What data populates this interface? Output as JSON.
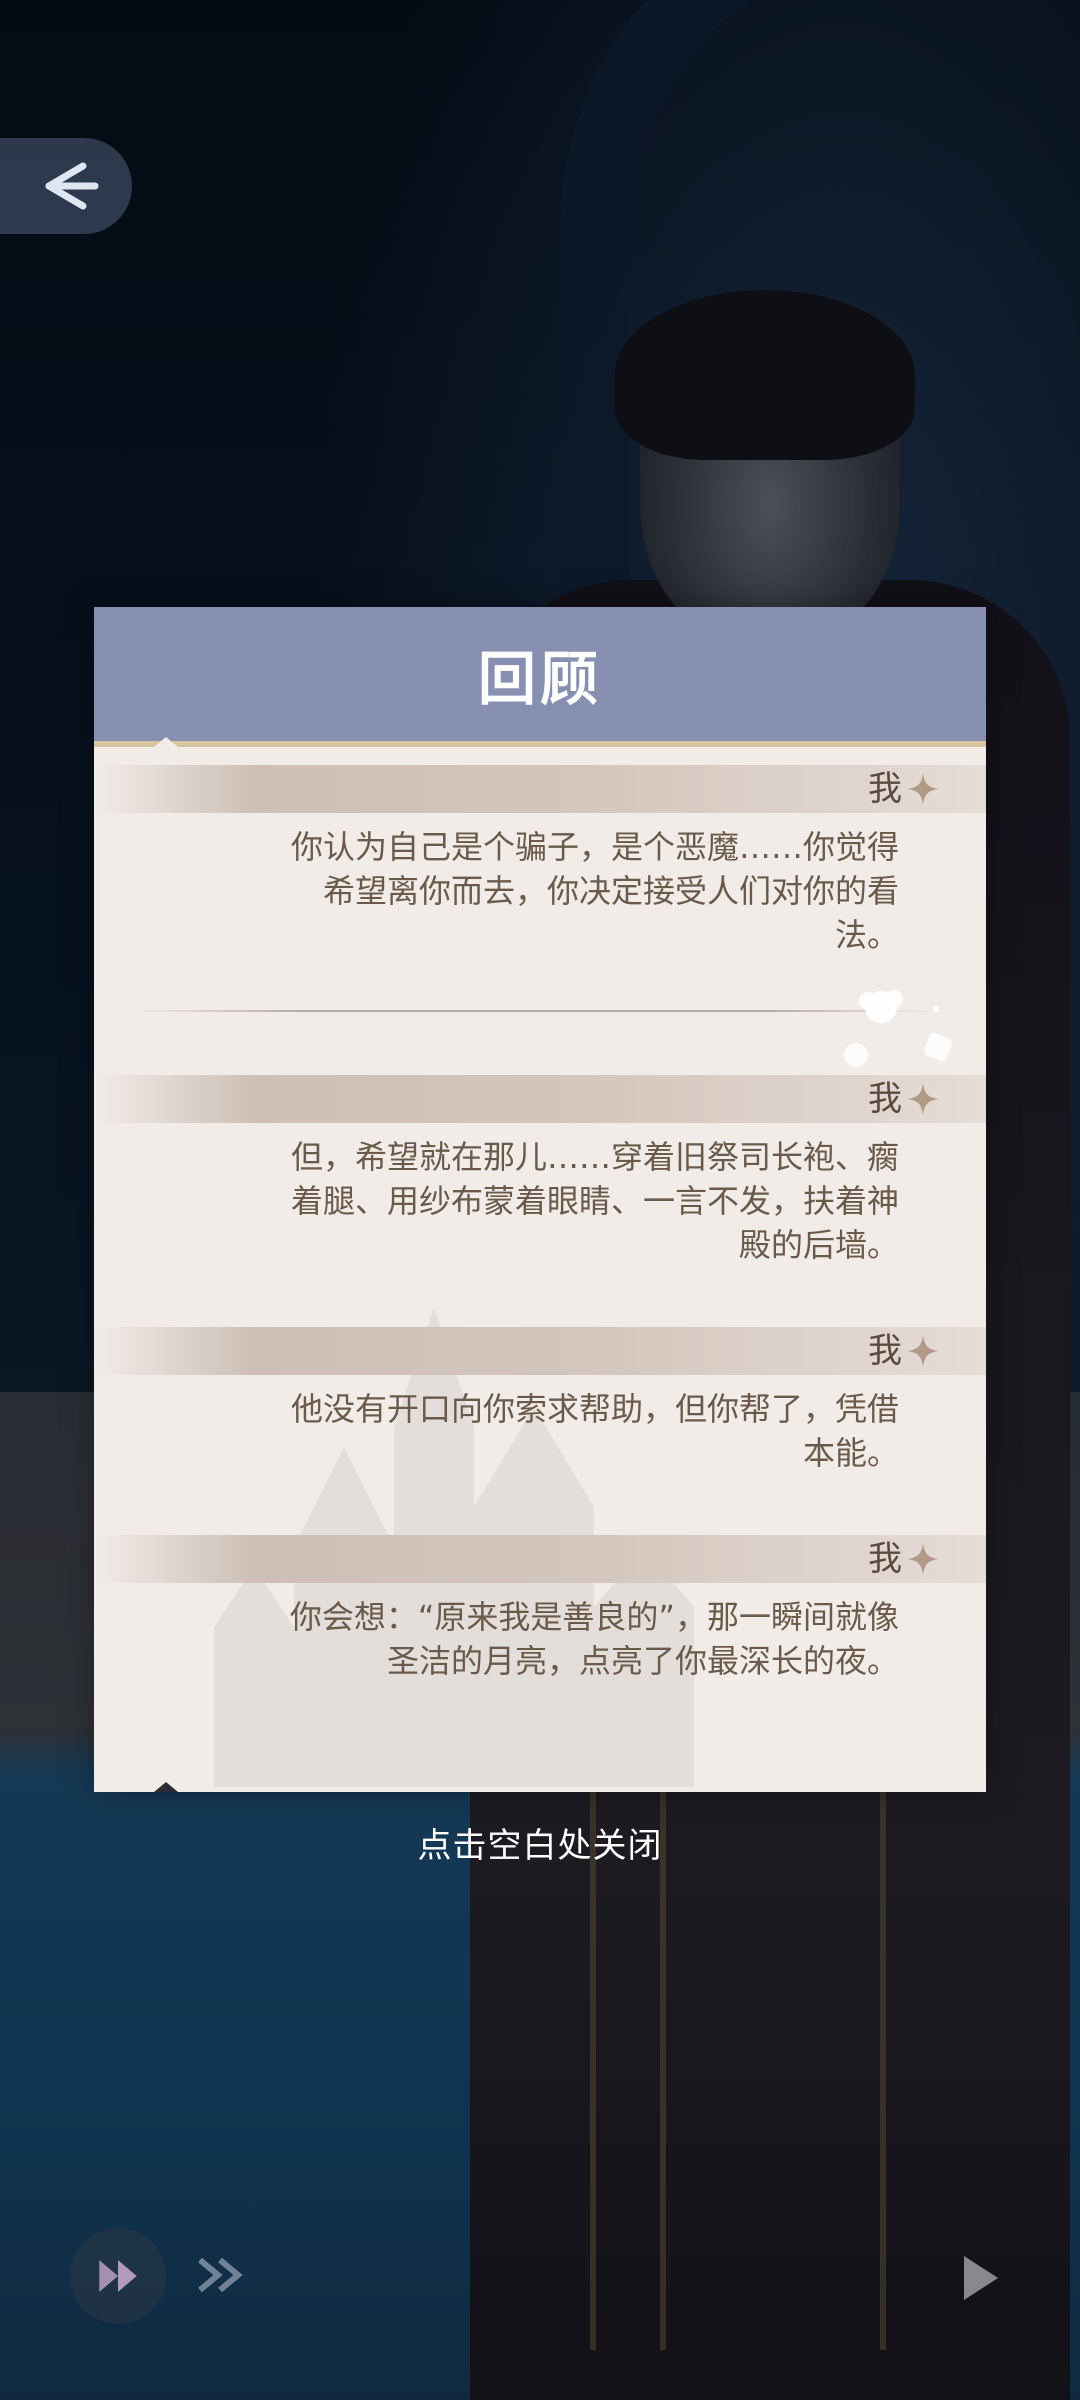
{
  "dialog": {
    "title": "回顾",
    "entries": [
      {
        "speaker": "我",
        "text": "你认为自己是个骗子，是个恶魔……你觉得希望离你而去，你决定接受人们对你的看法。"
      },
      {
        "speaker": "我",
        "text": "但，希望就在那儿……穿着旧祭司长袍、瘸着腿、用纱布蒙着眼睛、一言不发，扶着神殿的后墙。"
      },
      {
        "speaker": "我",
        "text": "他没有开口向你索求帮助，但你帮了，凭借本能。"
      },
      {
        "speaker": "我",
        "text": "你会想：“原来我是善良的”，那一瞬间就像圣洁的月亮，点亮了你最深长的夜。"
      }
    ]
  },
  "close_hint": "点击空白处关闭",
  "icons": {
    "back": "back-arrow-icon",
    "speaker_marker": "four-point-star-icon",
    "skip": "skip-icon",
    "play": "play-icon"
  },
  "colors": {
    "header": "#8790b1",
    "panel": "#f1ece8",
    "speaker_text": "#5b4a3d",
    "body_text": "#6b5a4a",
    "accent_line": "#d8c3a2"
  }
}
